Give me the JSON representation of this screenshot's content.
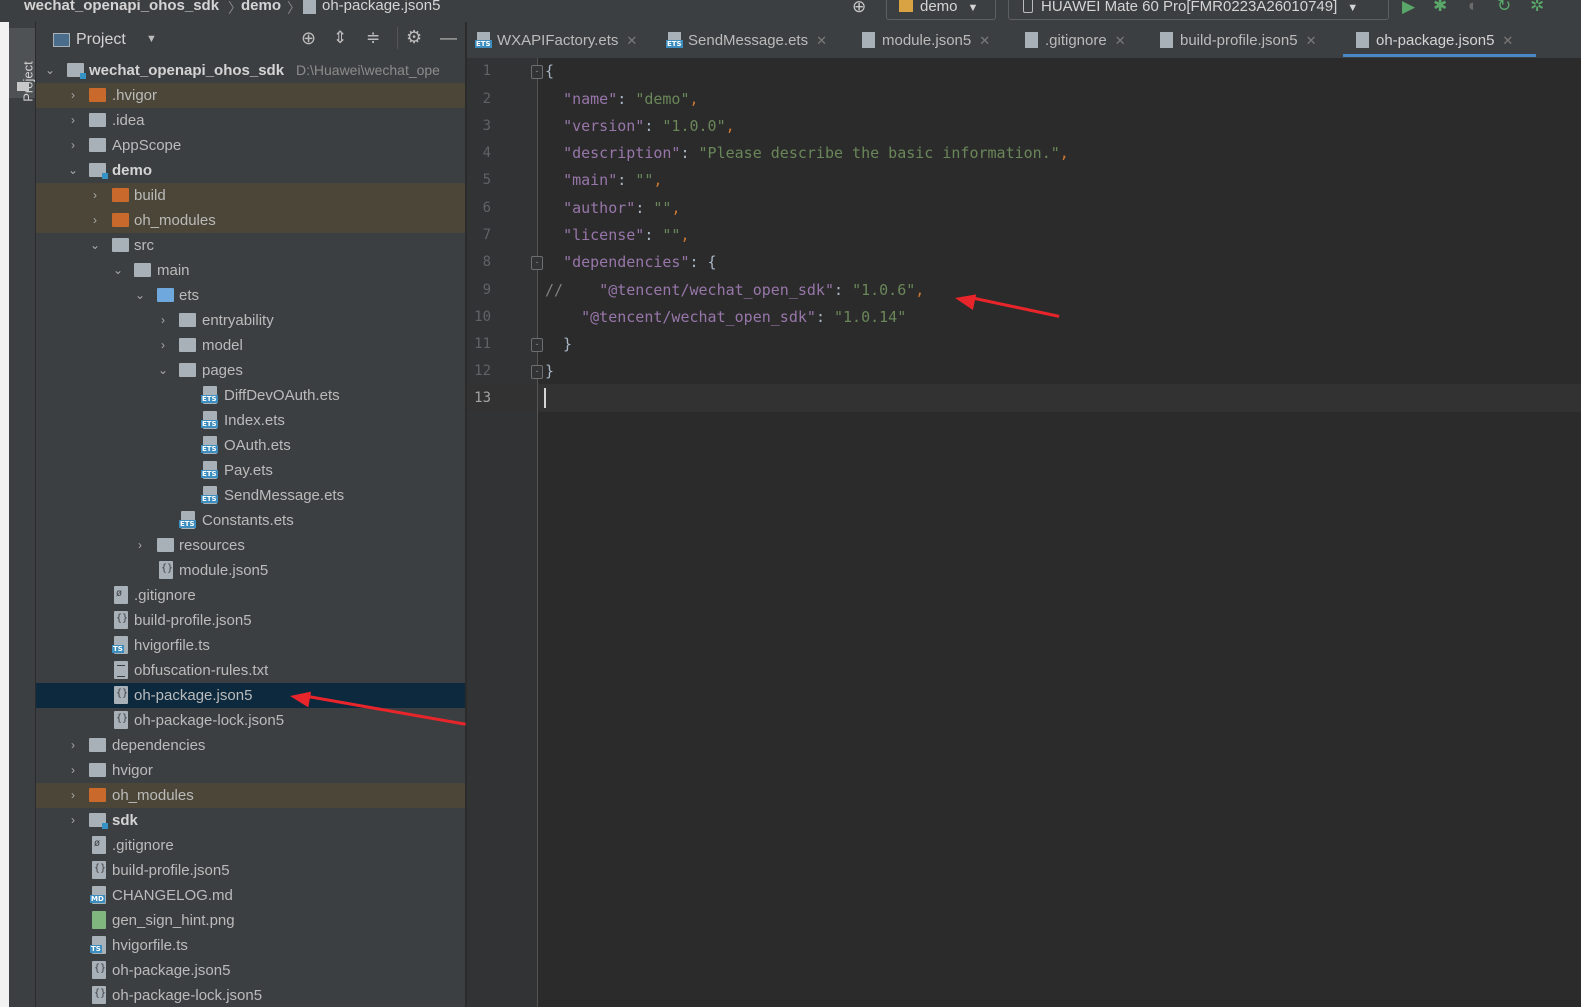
{
  "navbar": {
    "project": "wechat_openapi_ohos_sdk",
    "module": "demo",
    "file": "oh-package.json5",
    "run_config": "demo",
    "device": "HUAWEI Mate 60 Pro[FMR0223A26010749]"
  },
  "tool_window": {
    "project_tab": "Project"
  },
  "project_panel": {
    "title": "Project",
    "tree": [
      {
        "label": "wechat_openapi_ohos_sdk",
        "hint": "D:\\Huawei\\wechat_ope",
        "bold": true
      },
      {
        "label": ".hvigor"
      },
      {
        "label": ".idea"
      },
      {
        "label": "AppScope"
      },
      {
        "label": "demo",
        "bold": true
      },
      {
        "label": "build"
      },
      {
        "label": "oh_modules"
      },
      {
        "label": "src"
      },
      {
        "label": "main"
      },
      {
        "label": "ets"
      },
      {
        "label": "entryability"
      },
      {
        "label": "model"
      },
      {
        "label": "pages"
      },
      {
        "label": "DiffDevOAuth.ets"
      },
      {
        "label": "Index.ets"
      },
      {
        "label": "OAuth.ets"
      },
      {
        "label": "Pay.ets"
      },
      {
        "label": "SendMessage.ets"
      },
      {
        "label": "Constants.ets"
      },
      {
        "label": "resources"
      },
      {
        "label": "module.json5"
      },
      {
        "label": ".gitignore"
      },
      {
        "label": "build-profile.json5"
      },
      {
        "label": "hvigorfile.ts"
      },
      {
        "label": "obfuscation-rules.txt"
      },
      {
        "label": "oh-package.json5"
      },
      {
        "label": "oh-package-lock.json5"
      },
      {
        "label": "dependencies"
      },
      {
        "label": "hvigor"
      },
      {
        "label": "oh_modules"
      },
      {
        "label": "sdk",
        "bold": true
      },
      {
        "label": ".gitignore"
      },
      {
        "label": "build-profile.json5"
      },
      {
        "label": "CHANGELOG.md"
      },
      {
        "label": "gen_sign_hint.png"
      },
      {
        "label": "hvigorfile.ts"
      },
      {
        "label": "oh-package.json5"
      },
      {
        "label": "oh-package-lock.json5"
      }
    ]
  },
  "tabs": [
    {
      "label": "WXAPIFactory.ets"
    },
    {
      "label": "SendMessage.ets"
    },
    {
      "label": "module.json5"
    },
    {
      "label": ".gitignore"
    },
    {
      "label": "build-profile.json5"
    },
    {
      "label": "oh-package.json5",
      "active": true
    }
  ],
  "editor": {
    "line_numbers": [
      "1",
      "2",
      "3",
      "4",
      "5",
      "6",
      "7",
      "8",
      "9",
      "10",
      "11",
      "12",
      "13"
    ],
    "current_line": 13,
    "lines": [
      "{",
      "  \"name\": \"demo\",",
      "  \"version\": \"1.0.0\",",
      "  \"description\": \"Please describe the basic information.\",",
      "  \"main\": \"\",",
      "  \"author\": \"\",",
      "  \"license\": \"\",",
      "  \"dependencies\": {",
      "//    \"@tencent/wechat_open_sdk\": \"1.0.6\",",
      "    \"@tencent/wechat_open_sdk\": \"1.0.14\"",
      "  }",
      "}",
      ""
    ]
  },
  "colors": {
    "annotation_arrow": "#e8252a",
    "active_tab_underline": "#4a88c7",
    "selected_row": "#0d293e",
    "excluded_folder": "#c96a2c"
  }
}
